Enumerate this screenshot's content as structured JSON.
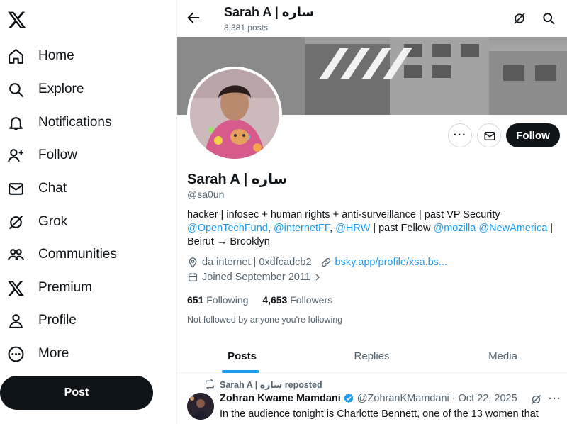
{
  "nav": {
    "logo": "x-logo-icon",
    "items": [
      {
        "label": "Home",
        "icon": "home-icon"
      },
      {
        "label": "Explore",
        "icon": "search-icon"
      },
      {
        "label": "Notifications",
        "icon": "bell-icon"
      },
      {
        "label": "Follow",
        "icon": "add-person-icon"
      },
      {
        "label": "Chat",
        "icon": "envelope-icon"
      },
      {
        "label": "Grok",
        "icon": "grok-icon"
      },
      {
        "label": "Communities",
        "icon": "people-icon"
      },
      {
        "label": "Premium",
        "icon": "x-logo-icon"
      },
      {
        "label": "Profile",
        "icon": "person-icon"
      },
      {
        "label": "More",
        "icon": "more-circle-icon"
      }
    ],
    "post_label": "Post"
  },
  "header": {
    "name": "Sarah A | ساره",
    "posts_count": "8,381 posts"
  },
  "profile": {
    "name": "Sarah A | ساره",
    "handle": "@sa0un",
    "follow_label": "Follow",
    "more_label": "···",
    "bio": {
      "line1": "hacker | infosec + human rights + anti-surveillance | past VP Security",
      "link1": "@OpenTechFund",
      "sep1": ", ",
      "link2": "@internetFF",
      "sep2": ", ",
      "link3": "@HRW",
      "mid": " | past Fellow ",
      "link4": "@mozilla",
      "sp": " ",
      "link5": "@NewAmerica",
      "end": " |",
      "line3": "Beirut → Brooklyn"
    },
    "location": "da internet | 0xdfcadcb2",
    "website": "bsky.app/profile/xsa.bs...",
    "joined": "Joined September 2011",
    "following_count": "651",
    "following_label": "Following",
    "followers_count": "4,653",
    "followers_label": "Followers",
    "not_followed": "Not followed by anyone you're following"
  },
  "tabs": [
    {
      "label": "Posts",
      "active": true
    },
    {
      "label": "Replies",
      "active": false
    },
    {
      "label": "Media",
      "active": false
    }
  ],
  "tweet": {
    "repost_label": "Sarah A | ساره reposted",
    "author_name": "Zohran Kwame Mamdani",
    "author_handle": "@ZohranKMamdani",
    "dot": "·",
    "date": "Oct 22, 2025",
    "text": "In the audience tonight is Charlotte Bennett, one of the 13 women that"
  },
  "colors": {
    "accent": "#1d9bf0",
    "text": "#0f1419",
    "muted": "#536471",
    "button_dark": "#0f1419"
  }
}
